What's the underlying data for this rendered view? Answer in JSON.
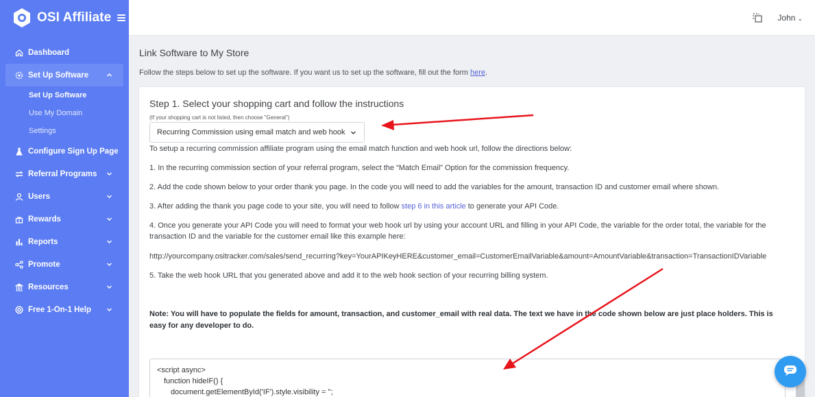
{
  "brand": {
    "name": "OSI Affiliate"
  },
  "sidebar": {
    "items": [
      {
        "label": "Dashboard",
        "icon": "home-icon"
      },
      {
        "label": "Set Up Software",
        "icon": "gear-icon",
        "active": true,
        "expanded": true,
        "children": [
          {
            "label": "Set Up Software",
            "current": true
          },
          {
            "label": "Use My Domain"
          },
          {
            "label": "Settings"
          }
        ]
      },
      {
        "label": "Configure Sign Up Page",
        "icon": "flask-icon"
      },
      {
        "label": "Referral Programs",
        "icon": "exchange-icon"
      },
      {
        "label": "Users",
        "icon": "user-icon"
      },
      {
        "label": "Rewards",
        "icon": "gift-icon"
      },
      {
        "label": "Reports",
        "icon": "bar-chart-icon"
      },
      {
        "label": "Promote",
        "icon": "share-icon"
      },
      {
        "label": "Resources",
        "icon": "bank-icon"
      },
      {
        "label": "Free 1-On-1 Help",
        "icon": "lifebuoy-icon"
      }
    ]
  },
  "topbar": {
    "user_name": "John",
    "icon": "copy-icon"
  },
  "page": {
    "title": "Link Software to My Store",
    "lead_text": "Follow the steps below to set up the software. If you want us to set up the software, fill out the form ",
    "lead_link": "here",
    "lead_end": "."
  },
  "step": {
    "title": "Step 1. Select your shopping cart and follow the instructions",
    "hint": "(If your shopping cart is not listed, then choose \"General\")",
    "selected_option": "Recurring Commission using email match and web hook",
    "intro": "To setup a recurring commission affiliate program using the email match function and web hook url, follow the directions below:",
    "p1": "1. In the recurring commission section of your referral program, select the “Match Email” Option for the commission frequency.",
    "p2": "2. Add the code shown below to your order thank you page. In the code you will need to add the variables for the amount, transaction ID and customer email where shown.",
    "p3_pre": "3. After adding the thank you page code to your site, you will need to follow ",
    "p3_link": "step 6 in this article",
    "p3_post": " to generate your API Code.",
    "p4": "4. Once you generate your API Code you will need to format your web hook url by using your account URL and filling in your API Code, the variable for the order total, the variable for the transaction ID and the variable for the customer email like this example here:",
    "url": "http://yourcompany.ositracker.com/sales/send_recurring?key=YourAPIKeyHERE&customer_email=CustomerEmailVariable&amount=AmountVariable&transaction=TransactionIDVariable",
    "p5": "5. Take the web hook URL that you generated above and add it to the web hook section of your recurring billing system.",
    "note": "Note: You will have to populate the fields for amount, transaction, and customer_email with real data. The text we have in the code shown below are just place holders. This is easy for any developer to do."
  },
  "code": {
    "line1": "<script async>",
    "line2": "function hideIF() {",
    "line3": "document.getElementById('IF').style.visibility = '';"
  },
  "colors": {
    "sidebar": "#5b7cf2",
    "accent": "#5561d7",
    "chat": "#2f9bf1",
    "arrow": "#e8141b"
  },
  "chat": {
    "icon": "chat-icon"
  }
}
